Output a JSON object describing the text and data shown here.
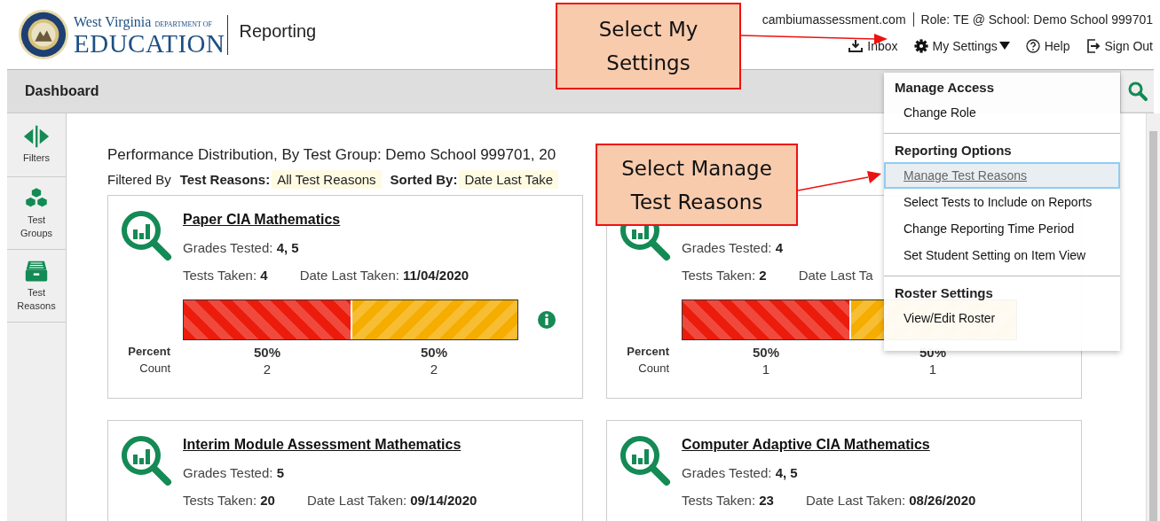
{
  "header": {
    "logo_line1": "West Virginia",
    "logo_dept": "DEPARTMENT OF",
    "logo_line2": "EDUCATION",
    "app_name": "Reporting",
    "user_email": "cambiumassessment.com",
    "role": "Role: TE @ School: Demo School 999701",
    "links": [
      {
        "kind": "inbox",
        "label": "Inbox"
      },
      {
        "kind": "settings",
        "label": "My Settings"
      },
      {
        "kind": "help",
        "label": "Help"
      },
      {
        "kind": "signout",
        "label": "Sign Out"
      }
    ]
  },
  "dashboard_bar": {
    "title": "Dashboard"
  },
  "sidebar": {
    "items": [
      {
        "kind": "filters",
        "label": "Filters"
      },
      {
        "kind": "groups",
        "label": "Test Groups"
      },
      {
        "kind": "reasons",
        "label": "Test Reasons"
      }
    ]
  },
  "report": {
    "heading": "Performance Distribution, By Test Group: Demo School 999701, 20",
    "filter_prefix": "Filtered By",
    "filters": [
      {
        "label": "Test Reasons:",
        "value": "All Test Reasons"
      },
      {
        "label": "Sorted By:",
        "value": "Date Last Take"
      }
    ]
  },
  "cards": [
    {
      "title": "Paper CIA Mathematics",
      "grades_label": "Grades Tested:",
      "grades": "4, 5",
      "tests_label": "Tests Taken:",
      "tests": "4",
      "date_label": "Date Last Taken:",
      "date": "11/04/2020",
      "percent_label": "Percent",
      "count_label": "Count",
      "distribution": [
        {
          "level": 0.5,
          "color": "#ec1c0c",
          "percent": "50%",
          "count": "2"
        },
        {
          "level": 0.5,
          "color": "#f5ad00",
          "percent": "50%",
          "count": "2"
        }
      ]
    },
    {
      "grades_label": "Grades Tested:",
      "grades": "4",
      "tests_label": "Tests Taken:",
      "tests": "2",
      "date_label": "Date Last Ta",
      "percent_label": "Percent",
      "count_label": "Count",
      "distribution": [
        {
          "level": 0.5,
          "color": "#ec1c0c",
          "percent": "50%",
          "count": "1"
        },
        {
          "level": 0.5,
          "color": "#f5ad00",
          "percent": "50%",
          "count": "1"
        }
      ]
    },
    {
      "title": "Interim Module Assessment Mathematics",
      "grades_label": "Grades Tested:",
      "grades": "5",
      "tests_label": "Tests Taken:",
      "tests": "20",
      "date_label": "Date Last Taken:",
      "date": "09/14/2020"
    },
    {
      "title": "Computer Adaptive CIA Mathematics",
      "grades_label": "Grades Tested:",
      "grades": "4, 5",
      "tests_label": "Tests Taken:",
      "tests": "23",
      "date_label": "Date Last Taken:",
      "date": "08/26/2020"
    }
  ],
  "settings_menu": {
    "sections": [
      {
        "title": "Manage Access",
        "items": [
          {
            "label": "Change Role",
            "selected": false
          }
        ]
      },
      {
        "title": "Reporting Options",
        "items": [
          {
            "label": "Manage Test Reasons",
            "selected": true
          },
          {
            "label": "Select Tests to Include on Reports",
            "selected": false
          },
          {
            "label": "Change Reporting Time Period",
            "selected": false
          },
          {
            "label": "Set Student Setting on Item View",
            "selected": false
          }
        ]
      },
      {
        "title": "Roster Settings",
        "items": [
          {
            "label": "View/Edit Roster",
            "selected": false
          }
        ]
      }
    ]
  },
  "callouts": [
    {
      "text": "Select My Settings"
    },
    {
      "text": "Select Manage Test Reasons"
    }
  ]
}
